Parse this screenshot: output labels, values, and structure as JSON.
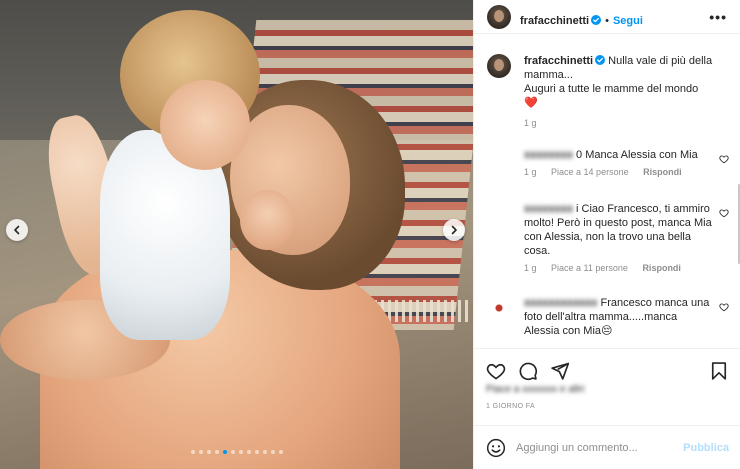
{
  "post": {
    "carousel": {
      "slide_count": 12,
      "active_index": 4
    },
    "header": {
      "username": "frafacchinetti",
      "separator": "•",
      "follow_label": "Segui",
      "more_label": "•••"
    },
    "caption": {
      "username": "frafacchinetti",
      "line1": "Nulla vale di più della mamma...",
      "line2": "Auguri a tutte le mamme del mondo",
      "emoji": "❤️",
      "time": "1 g"
    },
    "comments": [
      {
        "username": "",
        "text": "0 Manca Alessia con Mia",
        "time": "1 g",
        "likes": "Piace a 14 persone",
        "reply": "Rispondi"
      },
      {
        "username": "",
        "text": "i Ciao Francesco, ti ammiro molto! Però in questo post, manca Mia con Alessia, non la trovo una bella cosa.",
        "time": "1 g",
        "likes": "Piace a 11 persone",
        "reply": "Rispondi"
      },
      {
        "username": "",
        "text": "Francesco manca una foto dell'altra mamma.....manca Alessia con Mia😔",
        "time": "",
        "likes": "",
        "reply": ""
      }
    ],
    "date": "1 GIORNO FA",
    "add_comment": {
      "placeholder": "Aggiungi un commento...",
      "publish_label": "Pubblica"
    },
    "colors": {
      "accent": "#0095f6",
      "publish_disabled": "#b2dffc",
      "heart": "#ed4956",
      "verified": "#0095f6"
    }
  }
}
